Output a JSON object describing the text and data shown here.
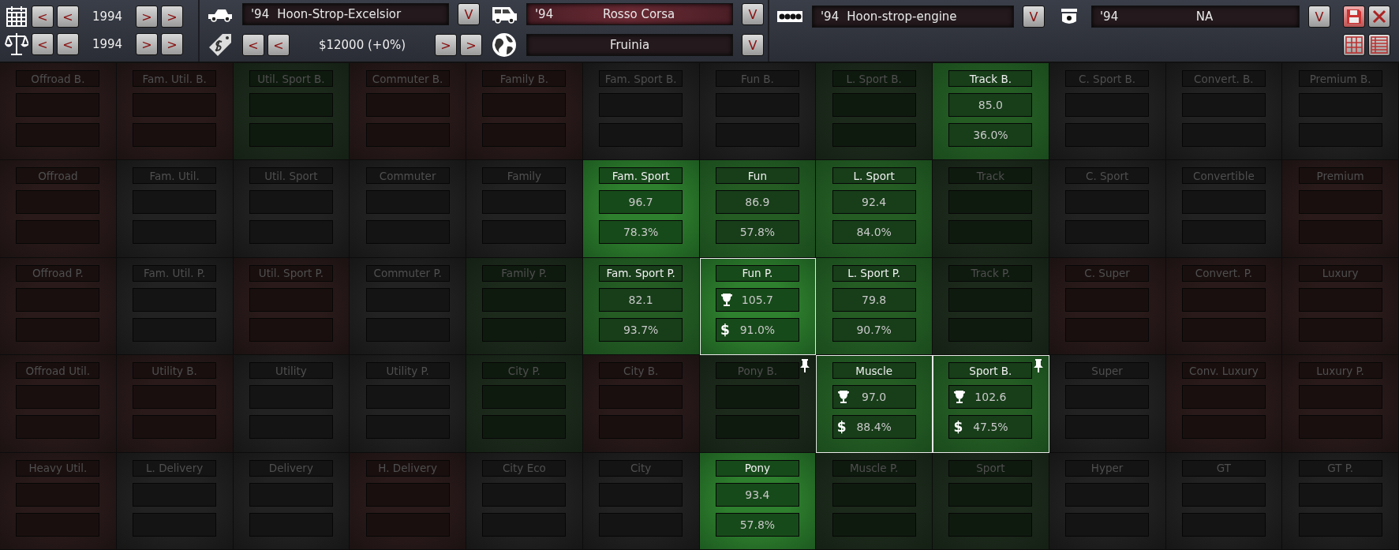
{
  "toolbar": {
    "year_filters": [
      {
        "prev": [
          "<",
          "<"
        ],
        "year": "1994",
        "next": [
          ">",
          ">"
        ]
      },
      {
        "prev": [
          "<",
          "<"
        ],
        "year": "1994",
        "next": [
          ">",
          ">"
        ]
      }
    ],
    "selectors_top": [
      {
        "year": "'94",
        "name": "Hoon-Strop-Excelsior",
        "kind": "plain",
        "dropdown": "V"
      },
      {
        "year": "'94",
        "name": "Rosso Corsa",
        "kind": "tinted",
        "dropdown": "V"
      },
      {
        "year": "'94",
        "name": "Hoon-strop-engine",
        "kind": "plain",
        "dropdown": "V"
      },
      {
        "year": "'94",
        "name": "NA",
        "kind": "plain",
        "dropdown": "V"
      }
    ],
    "price": {
      "prev": [
        "<",
        "<"
      ],
      "value": "$12000 (+0%)",
      "next": [
        ">",
        ">"
      ]
    },
    "region": {
      "name": "Fruinia",
      "dropdown": "V"
    }
  },
  "segments": [
    [
      {
        "label": "Offroad B.",
        "kind": "red",
        "active": false
      },
      {
        "label": "Fam. Util. B.",
        "kind": "red",
        "active": false
      },
      {
        "label": "Util. Sport B.",
        "kind": "dim",
        "active": false
      },
      {
        "label": "Commuter B.",
        "kind": "red",
        "active": false
      },
      {
        "label": "Family B.",
        "kind": "red",
        "active": false
      },
      {
        "label": "Fam. Sport B.",
        "kind": "neutral",
        "active": false
      },
      {
        "label": "Fun B.",
        "kind": "neutral",
        "active": false
      },
      {
        "label": "L. Sport B.",
        "kind": "dim",
        "active": false
      },
      {
        "label": "Track B.",
        "kind": "green",
        "active": true,
        "score": "85.0",
        "share": "36.0%"
      },
      {
        "label": "C. Sport B.",
        "kind": "neutral",
        "active": false
      },
      {
        "label": "Convert. B.",
        "kind": "neutral",
        "active": false
      },
      {
        "label": "Premium B.",
        "kind": "neutral",
        "active": false
      }
    ],
    [
      {
        "label": "Offroad",
        "kind": "red",
        "active": false
      },
      {
        "label": "Fam. Util.",
        "kind": "neutral",
        "active": false
      },
      {
        "label": "Util. Sport",
        "kind": "neutral",
        "active": false
      },
      {
        "label": "Commuter",
        "kind": "neutral",
        "active": false
      },
      {
        "label": "Family",
        "kind": "neutral",
        "active": false
      },
      {
        "label": "Fam. Sport",
        "kind": "bright",
        "active": true,
        "score": "96.7",
        "share": "78.3%"
      },
      {
        "label": "Fun",
        "kind": "green",
        "active": true,
        "score": "86.9",
        "share": "57.8%"
      },
      {
        "label": "L. Sport",
        "kind": "green",
        "active": true,
        "score": "92.4",
        "share": "84.0%"
      },
      {
        "label": "Track",
        "kind": "dim",
        "active": false
      },
      {
        "label": "C. Sport",
        "kind": "neutral",
        "active": false
      },
      {
        "label": "Convertible",
        "kind": "neutral",
        "active": false
      },
      {
        "label": "Premium",
        "kind": "red",
        "active": false
      }
    ],
    [
      {
        "label": "Offroad P.",
        "kind": "red",
        "active": false
      },
      {
        "label": "Fam. Util. P.",
        "kind": "neutral",
        "active": false
      },
      {
        "label": "Util. Sport P.",
        "kind": "red",
        "active": false
      },
      {
        "label": "Commuter P.",
        "kind": "neutral",
        "active": false
      },
      {
        "label": "Family P.",
        "kind": "dim",
        "active": false
      },
      {
        "label": "Fam. Sport P.",
        "kind": "green",
        "active": true,
        "score": "82.1",
        "share": "93.7%"
      },
      {
        "label": "Fun P.",
        "kind": "bright",
        "active": true,
        "selected": true,
        "trophy": true,
        "currency": "$",
        "score": "105.7",
        "share": "91.0%"
      },
      {
        "label": "L. Sport P.",
        "kind": "green",
        "active": true,
        "score": "79.8",
        "share": "90.7%"
      },
      {
        "label": "Track P.",
        "kind": "dim",
        "active": false
      },
      {
        "label": "C. Super",
        "kind": "red",
        "active": false
      },
      {
        "label": "Convert. P.",
        "kind": "red",
        "active": false
      },
      {
        "label": "Luxury",
        "kind": "red",
        "active": false
      }
    ],
    [
      {
        "label": "Offroad Util.",
        "kind": "red",
        "active": false
      },
      {
        "label": "Utility B.",
        "kind": "red",
        "active": false
      },
      {
        "label": "Utility",
        "kind": "neutral",
        "active": false
      },
      {
        "label": "Utility P.",
        "kind": "neutral",
        "active": false
      },
      {
        "label": "City P.",
        "kind": "dim",
        "active": false
      },
      {
        "label": "City B.",
        "kind": "red",
        "active": false
      },
      {
        "label": "Pony B.",
        "kind": "dim",
        "active": false,
        "pinned": true
      },
      {
        "label": "Muscle",
        "kind": "green",
        "active": true,
        "selected": true,
        "trophy": true,
        "currency": "$",
        "score": "97.0",
        "share": "88.4%"
      },
      {
        "label": "Sport B.",
        "kind": "green",
        "active": true,
        "selected": true,
        "pinned": true,
        "trophy": true,
        "currency": "$",
        "score": "102.6",
        "share": "47.5%"
      },
      {
        "label": "Super",
        "kind": "neutral",
        "active": false
      },
      {
        "label": "Conv. Luxury",
        "kind": "red",
        "active": false
      },
      {
        "label": "Luxury P.",
        "kind": "red",
        "active": false
      }
    ],
    [
      {
        "label": "Heavy Util.",
        "kind": "red",
        "active": false
      },
      {
        "label": "L. Delivery",
        "kind": "neutral",
        "active": false
      },
      {
        "label": "Delivery",
        "kind": "neutral",
        "active": false
      },
      {
        "label": "H. Delivery",
        "kind": "red",
        "active": false
      },
      {
        "label": "City Eco",
        "kind": "neutral",
        "active": false
      },
      {
        "label": "City",
        "kind": "neutral",
        "active": false
      },
      {
        "label": "Pony",
        "kind": "bright",
        "active": true,
        "score": "93.4",
        "share": "57.8%"
      },
      {
        "label": "Muscle P.",
        "kind": "dim",
        "active": false
      },
      {
        "label": "Sport",
        "kind": "dim",
        "active": false
      },
      {
        "label": "Hyper",
        "kind": "neutral",
        "active": false
      },
      {
        "label": "GT",
        "kind": "neutral",
        "active": false
      },
      {
        "label": "GT P.",
        "kind": "neutral",
        "active": false
      }
    ]
  ]
}
